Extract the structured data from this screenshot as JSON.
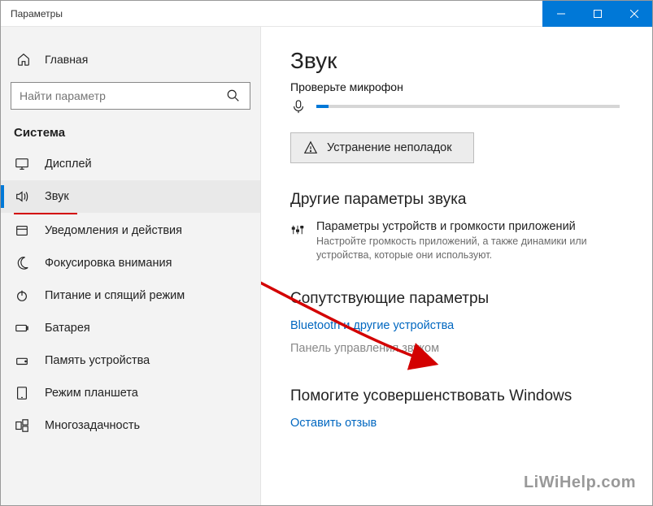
{
  "titlebar": {
    "title": "Параметры"
  },
  "sidebar": {
    "home": "Главная",
    "search_placeholder": "Найти параметр",
    "category": "Система",
    "items": [
      {
        "label": "Дисплей"
      },
      {
        "label": "Звук"
      },
      {
        "label": "Уведомления и действия"
      },
      {
        "label": "Фокусировка внимания"
      },
      {
        "label": "Питание и спящий режим"
      },
      {
        "label": "Батарея"
      },
      {
        "label": "Память устройства"
      },
      {
        "label": "Режим планшета"
      },
      {
        "label": "Многозадачность"
      }
    ]
  },
  "main": {
    "title": "Звук",
    "mic_prompt": "Проверьте микрофон",
    "troubleshoot": "Устранение неполадок",
    "sec_other": "Другие параметры звука",
    "opt_mixer_title": "Параметры устройств и громкости приложений",
    "opt_mixer_desc": "Настройте громкость приложений, а также динамики или устройства, которые они используют.",
    "sec_related": "Сопутствующие параметры",
    "link_bt": "Bluetooth и другие устройства",
    "link_panel": "Панель управления звуком",
    "sec_improve": "Помогите усовершенствовать Windows",
    "link_feedback": "Оставить отзыв"
  },
  "watermark": "LiWiHelp.com"
}
